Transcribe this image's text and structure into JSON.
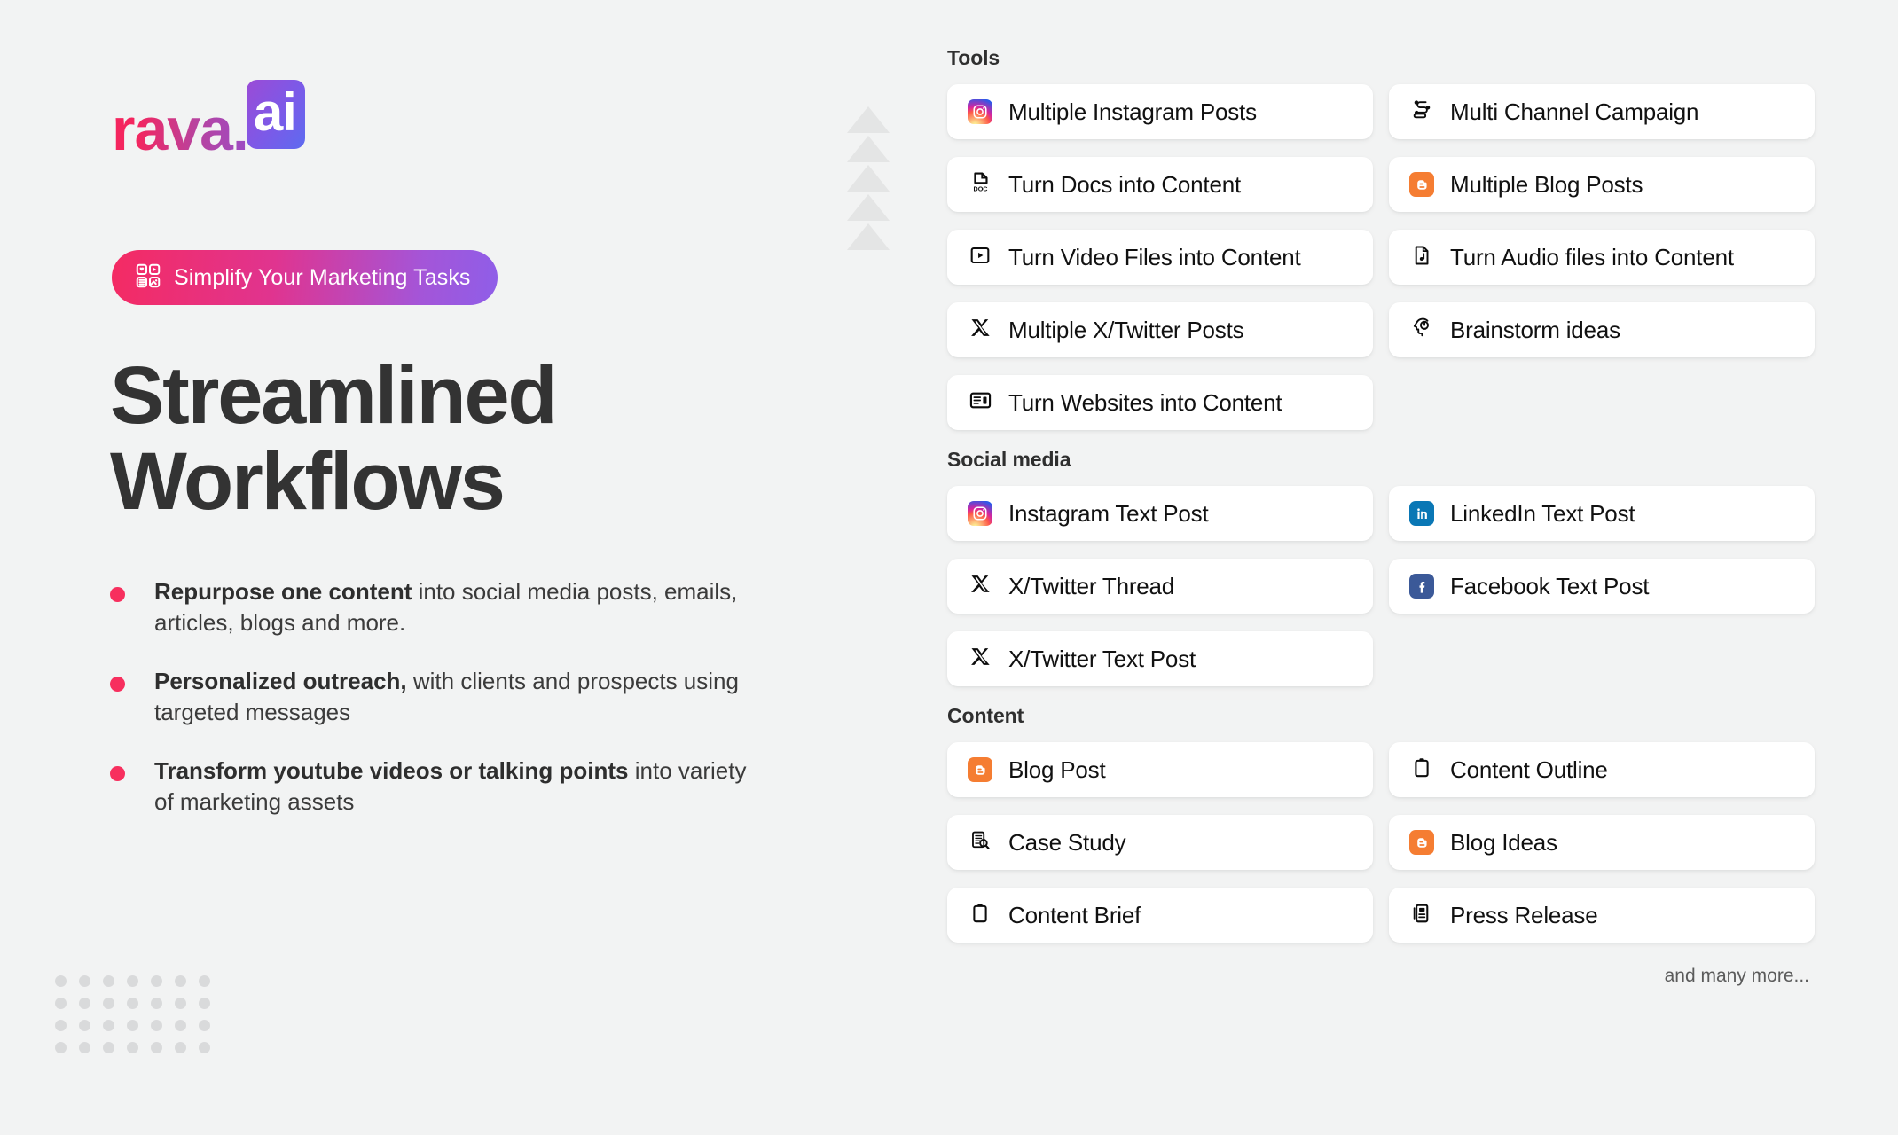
{
  "brand": {
    "logo_word": "rava.",
    "logo_badge": "ai",
    "gradient_start": "#f4255e",
    "gradient_end": "#5d6bf0"
  },
  "hero": {
    "pill_label": "Simplify Your Marketing Tasks",
    "headline_line1": "Streamlined",
    "headline_line2": "Workflows",
    "bullets": [
      {
        "strong": "Repurpose one content",
        "rest": " into social media posts, emails, articles, blogs and more."
      },
      {
        "strong": "Personalized outreach,",
        "rest": " with clients and prospects using targeted messages"
      },
      {
        "strong": "Transform youtube videos or talking points",
        "rest": " into variety of marketing assets"
      }
    ],
    "bullet_dot_color": "#f72f5e"
  },
  "panels": {
    "more_text": "and many more...",
    "sections": [
      {
        "title": "Tools",
        "cards": [
          {
            "label": "Multiple Instagram Posts",
            "icon": "instagram-icon"
          },
          {
            "label": "Multi Channel Campaign",
            "icon": "multi-channel-icon"
          },
          {
            "label": "Turn Docs into Content",
            "icon": "doc-file-icon"
          },
          {
            "label": "Multiple Blog Posts",
            "icon": "blogger-icon"
          },
          {
            "label": "Turn Video Files into Content",
            "icon": "video-play-icon"
          },
          {
            "label": "Turn Audio files into Content",
            "icon": "audio-file-icon"
          },
          {
            "label": "Multiple X/Twitter Posts",
            "icon": "x-twitter-icon"
          },
          {
            "label": "Brainstorm ideas",
            "icon": "brainstorm-head-icon"
          },
          {
            "label": "Turn Websites into Content",
            "icon": "website-layout-icon"
          }
        ]
      },
      {
        "title": "Social media",
        "cards": [
          {
            "label": "Instagram Text Post",
            "icon": "instagram-icon"
          },
          {
            "label": "LinkedIn Text Post",
            "icon": "linkedin-icon"
          },
          {
            "label": "X/Twitter Thread",
            "icon": "x-twitter-icon"
          },
          {
            "label": "Facebook Text Post",
            "icon": "facebook-icon"
          },
          {
            "label": "X/Twitter Text Post",
            "icon": "x-twitter-icon"
          }
        ]
      },
      {
        "title": "Content",
        "cards": [
          {
            "label": "Blog Post",
            "icon": "blogger-icon"
          },
          {
            "label": "Content Outline",
            "icon": "clipboard-icon"
          },
          {
            "label": "Case Study",
            "icon": "clipboard-search-icon"
          },
          {
            "label": "Blog Ideas",
            "icon": "blogger-icon"
          },
          {
            "label": "Content Brief",
            "icon": "clipboard-icon"
          },
          {
            "label": "Press Release",
            "icon": "press-release-icon"
          }
        ]
      }
    ]
  },
  "decor": {
    "triangle_count": 5,
    "triangle_color": "#e4e5e5",
    "dot_grid_cols": 7,
    "dot_grid_rows": 4,
    "dot_color": "#d9dadb"
  }
}
